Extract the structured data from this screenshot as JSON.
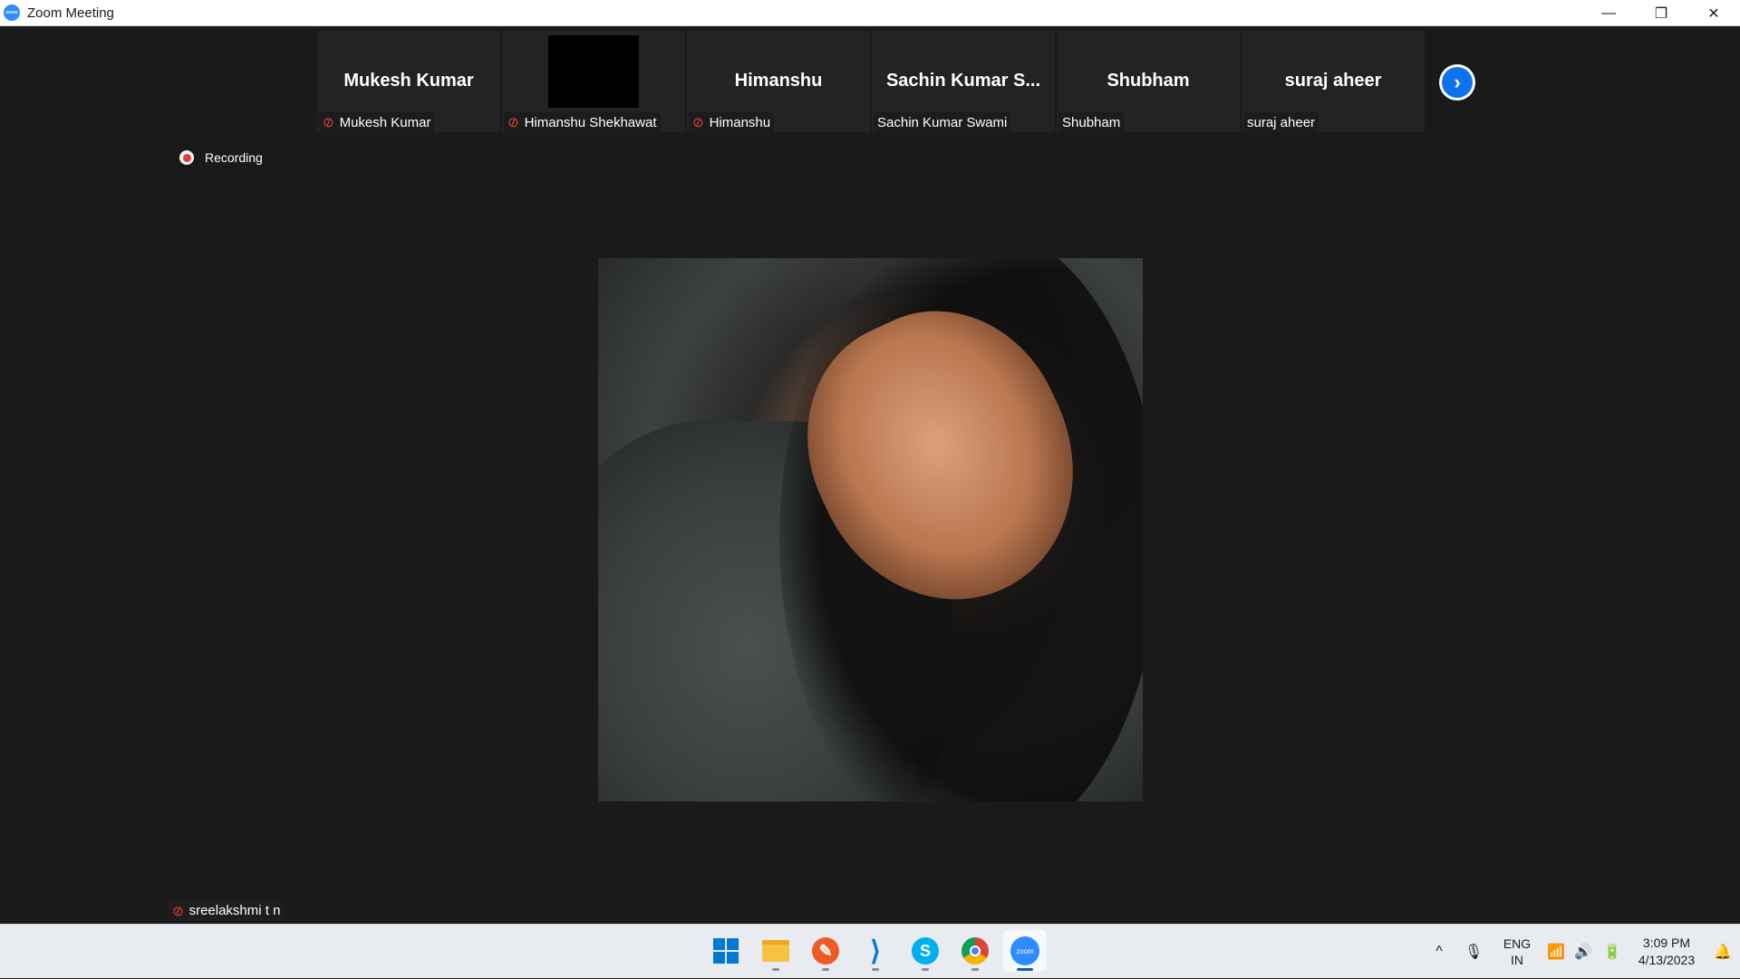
{
  "window": {
    "app_icon_text": "zoom",
    "title": "Zoom Meeting",
    "controls": {
      "minimize": "—",
      "restore": "❐",
      "close": "✕"
    }
  },
  "thumbnails": [
    {
      "display_name": "Mukesh Kumar",
      "label": "Mukesh Kumar",
      "muted": true,
      "video_on": false
    },
    {
      "display_name": "",
      "label": "Himanshu Shekhawat",
      "muted": true,
      "video_on": true
    },
    {
      "display_name": "Himanshu",
      "label": "Himanshu",
      "muted": true,
      "video_on": false
    },
    {
      "display_name": "Sachin Kumar S...",
      "label": "Sachin Kumar Swami",
      "muted": false,
      "video_on": false
    },
    {
      "display_name": "Shubham",
      "label": "Shubham",
      "muted": false,
      "video_on": false
    },
    {
      "display_name": "suraj aheer",
      "label": "suraj aheer",
      "muted": false,
      "video_on": false
    }
  ],
  "next_page_icon": "›",
  "recording": {
    "label": "Recording"
  },
  "active_speaker": {
    "label": "sreelakshmi t n",
    "muted": true
  },
  "mute_icon": "🎤",
  "taskbar": {
    "apps": [
      {
        "name": "start",
        "icon": "windows-logo"
      },
      {
        "name": "file-explorer",
        "icon": "folder"
      },
      {
        "name": "postman",
        "icon": "postman",
        "glyph": "✎"
      },
      {
        "name": "vs-code",
        "icon": "vscode",
        "glyph": "⟩"
      },
      {
        "name": "skype",
        "icon": "skype",
        "glyph": "S"
      },
      {
        "name": "chrome",
        "icon": "chrome"
      },
      {
        "name": "zoom",
        "icon": "zoom",
        "glyph": "zoom"
      }
    ],
    "tray": {
      "chevron": "^",
      "mic": "🎙",
      "lang_top": "ENG",
      "lang_bottom": "IN",
      "wifi": "📶",
      "volume": "🔊",
      "battery": "🔋",
      "time": "3:09 PM",
      "date": "4/13/2023",
      "notification": "🔔"
    }
  },
  "colors": {
    "accent_blue": "#0e72ed",
    "zoom_blue": "#2d8cff",
    "mute_red": "#e0413b",
    "background": "#1a1a1a"
  }
}
